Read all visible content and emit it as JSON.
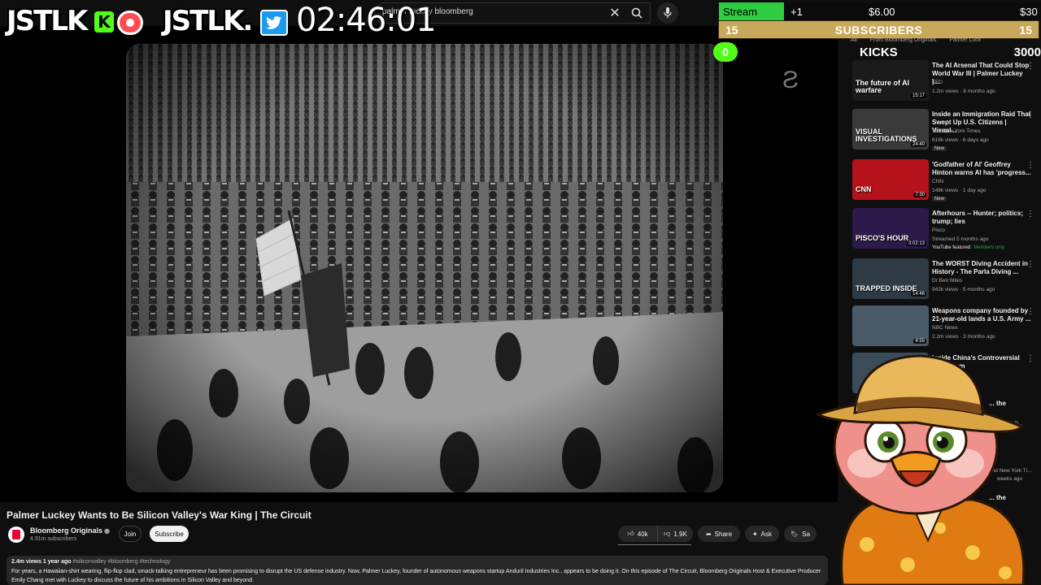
{
  "search": {
    "query": "palmer luckey bloomberg"
  },
  "overlay": {
    "logo_text": "JSTLK",
    "logo_text_2": "JSTLK.",
    "kick_letter": "K",
    "timer": "02:46:01",
    "stream_hours": {
      "label": "Stream Hours",
      "increment": "+1",
      "money": "$6.00",
      "goal": "$30"
    },
    "subscribers": {
      "current": "15",
      "label": "SUBSCRIBERS",
      "goal": "15",
      "progress": 1.0
    },
    "kicks": {
      "current": "0",
      "label": "KICKS",
      "goal": "3000",
      "progress": 0.0
    },
    "colors": {
      "green": "#2ecc40",
      "gold": "#c8a95b",
      "kick": "#53fc18",
      "twitter": "#1d9bf0"
    }
  },
  "video": {
    "title": "Palmer Luckey Wants to Be Silicon Valley's War King | The Circuit",
    "channel": "Bloomberg Originals",
    "subscribers": "4.91m subscribers",
    "join_label": "Join",
    "subscribe_label": "Subscribe",
    "likes": "40k",
    "dislikes": "1.9K",
    "share_label": "Share",
    "ask_label": "Ask",
    "save_label": "Sa",
    "description": {
      "meta": "2.4m views  1 year ago",
      "tags": "#siliconvalley #bloomberg #technology",
      "text": "For years, a Hawaiian-shirt wearing, flip-flop clad, smack-talking entrepreneur has been promising to disrupt the US defense industry. Now, Palmer Luckey, founder of autonomous weapons startup Anduril Industries Inc., appears to be doing it. On this episode of The Circuit, Bloomberg Originals Host & Executive Producer Emily Chang met with Luckey to discuss the future of his ambitions in Silicon Valley and beyond."
    }
  },
  "sidebar": {
    "chips": [
      "All",
      "From Bloomberg Originals",
      "Palmer Luck"
    ],
    "items": [
      {
        "title": "The AI Arsenal That Could Stop World War III | Palmer Luckey |...",
        "channel": "TED",
        "stats": "1.2m views · 8 months ago",
        "duration": "15:17",
        "thumb_text": "The future of AI warfare",
        "thumb_color": "#1b1b1b",
        "badge": ""
      },
      {
        "title": "Inside an Immigration Raid That Swept Up U.S. Citizens | Visual...",
        "channel": "The New York Times",
        "stats": "616k views · 6 days ago",
        "duration": "24:40",
        "thumb_text": "VISUAL INVESTIGATIONS",
        "thumb_color": "#3a3a3a",
        "badge": "New"
      },
      {
        "title": "'Godfather of AI' Geoffrey Hinton warns AI has 'progress...",
        "channel": "CNN",
        "stats": "148k views · 1 day ago",
        "duration": "7:30",
        "thumb_text": "CNN",
        "thumb_color": "#b5121b",
        "badge": "New"
      },
      {
        "title": "Afterhours -- Hunter; politics; trump; lies",
        "channel": "Pisco",
        "stats": "Streamed 5 months ago",
        "duration": "3:02:13",
        "thumb_text": "PISCO'S HOUR",
        "thumb_color": "#2b1a4a",
        "badge": "YouTube featured",
        "badge_extra": "Members only"
      },
      {
        "title": "The WORST Diving Accident in History - The Parla Diving ...",
        "channel": "Dr Ben Miles",
        "stats": "942k views · 5 months ago",
        "duration": "14:46",
        "thumb_text": "TRAPPED INSIDE",
        "thumb_color": "#2e3a44",
        "badge": ""
      },
      {
        "title": "Weapons company founded by 21-year-old lands a U.S. Army ...",
        "channel": "NBC News",
        "stats": "2.2m views · 3 months ago",
        "duration": "4:55",
        "thumb_text": "",
        "thumb_color": "#4a5a66",
        "badge": ""
      },
      {
        "title": "Inside China's Controversial Mega-Dam",
        "channel": "",
        "stats": "",
        "duration": "",
        "thumb_text": "",
        "thumb_color": "#3b4d5a",
        "badge": ""
      }
    ],
    "partial_titles": [
      "... the",
      "... the"
    ],
    "partial_channels": [
      "New York Ti...",
      "and New York Ti..."
    ],
    "partial_stats": [
      "weeks ago"
    ]
  }
}
